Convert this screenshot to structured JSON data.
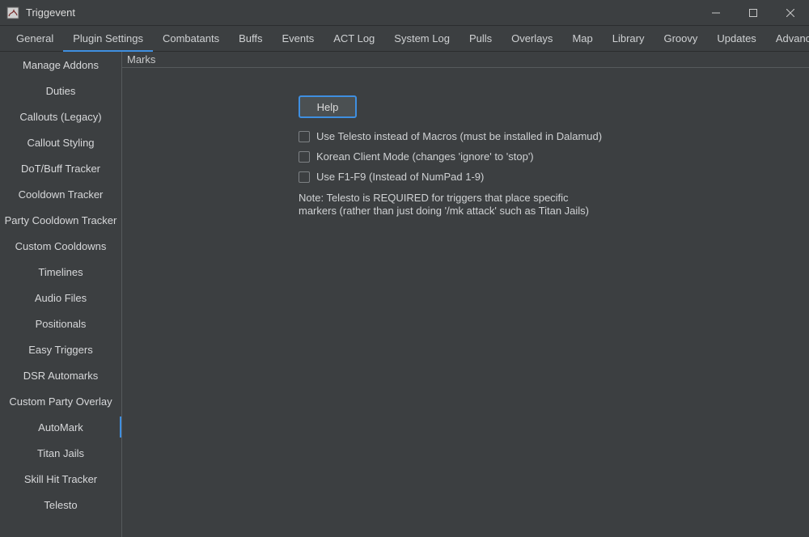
{
  "window": {
    "title": "Triggevent"
  },
  "top_tabs": [
    {
      "label": "General"
    },
    {
      "label": "Plugin Settings"
    },
    {
      "label": "Combatants"
    },
    {
      "label": "Buffs"
    },
    {
      "label": "Events"
    },
    {
      "label": "ACT Log"
    },
    {
      "label": "System Log"
    },
    {
      "label": "Pulls"
    },
    {
      "label": "Overlays"
    },
    {
      "label": "Map"
    },
    {
      "label": "Library"
    },
    {
      "label": "Groovy"
    },
    {
      "label": "Updates"
    },
    {
      "label": "Advanced"
    }
  ],
  "top_tab_active": 1,
  "sidebar": {
    "items": [
      "Manage Addons",
      "Duties",
      "Callouts (Legacy)",
      "Callout Styling",
      "DoT/Buff Tracker",
      "Cooldown Tracker",
      "Party Cooldown Tracker",
      "Custom Cooldowns",
      "Timelines",
      "Audio Files",
      "Positionals",
      "Easy Triggers",
      "DSR Automarks",
      "Custom Party Overlay",
      "AutoMark",
      "Titan Jails",
      "Skill Hit Tracker",
      "Telesto"
    ],
    "selected": 14
  },
  "content": {
    "section_title": "Marks",
    "help_label": "Help",
    "check_telesto": "Use Telesto instead of Macros (must be installed in Dalamud)",
    "check_korean": "Korean Client Mode (changes 'ignore' to 'stop')",
    "check_fkeys": "Use F1-F9 (Instead of NumPad 1-9)",
    "note": "Note: Telesto is REQUIRED for triggers that place specific markers (rather than just doing '/mk attack' such as Titan Jails)"
  }
}
